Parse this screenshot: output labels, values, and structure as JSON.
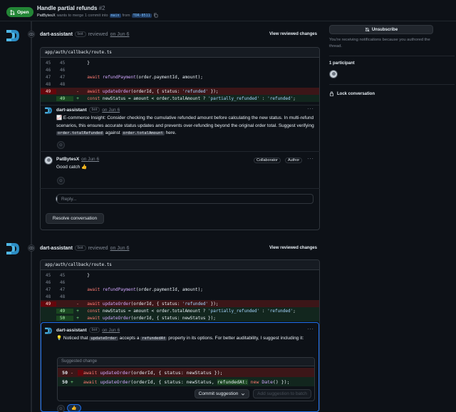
{
  "header": {
    "status": "Open",
    "title": "Handle partial refunds",
    "number": "#2",
    "author": "PatBytesX",
    "merge_text": "wants to merge 1 commit into",
    "base_branch": "main",
    "from_text": "from",
    "head_branch": "TDR-8511"
  },
  "sidebar": {
    "unsubscribe": "Unsubscribe",
    "notice": "You're receiving notifications because you authored the thread.",
    "participants": "1 participant",
    "lock": "Lock conversation"
  },
  "review1": {
    "author": "dart-assistant",
    "bot_label": "bot",
    "action": "reviewed",
    "date": "on Jun 6",
    "view_changes": "View reviewed changes",
    "file": "app/auth/callback/route.ts",
    "comment": {
      "author": "dart-assistant",
      "bot_label": "bot",
      "date": "on Jun 6",
      "text_pre": "E-commerce Insight: Consider checking the cumulative refunded amount before calculating the new status. In multi-refund scenarios, this ensures accurate status updates and prevents over-refunding beyond the original order total. Suggest verifying",
      "code1": "order.totalRefunded",
      "text_mid": "against",
      "code2": "order.totalAmount",
      "text_post": "here."
    },
    "reply": {
      "author": "PatBytesX",
      "date": "on Jun 6",
      "role1": "Collaborator",
      "role2": "Author",
      "text": "Good catch 👍"
    },
    "reply_placeholder": "Reply...",
    "resolve": "Resolve conversation"
  },
  "review2": {
    "author": "dart-assistant",
    "bot_label": "bot",
    "action": "reviewed",
    "date": "on Jun 6",
    "view_changes": "View reviewed changes",
    "file": "app/auth/callback/route.ts",
    "comment": {
      "author": "dart-assistant",
      "bot_label": "bot",
      "date": "on Jun 6",
      "text_pre": "Noticed that",
      "code1": "updateOrder",
      "text_mid": "accepts a",
      "code2": "refundedAt",
      "text_post": "property in its options. For better auditability, I suggest including it:"
    },
    "suggest_head": "Suggested change",
    "commit": "Commit suggestion",
    "add_batch": "Add suggestion to batch"
  }
}
